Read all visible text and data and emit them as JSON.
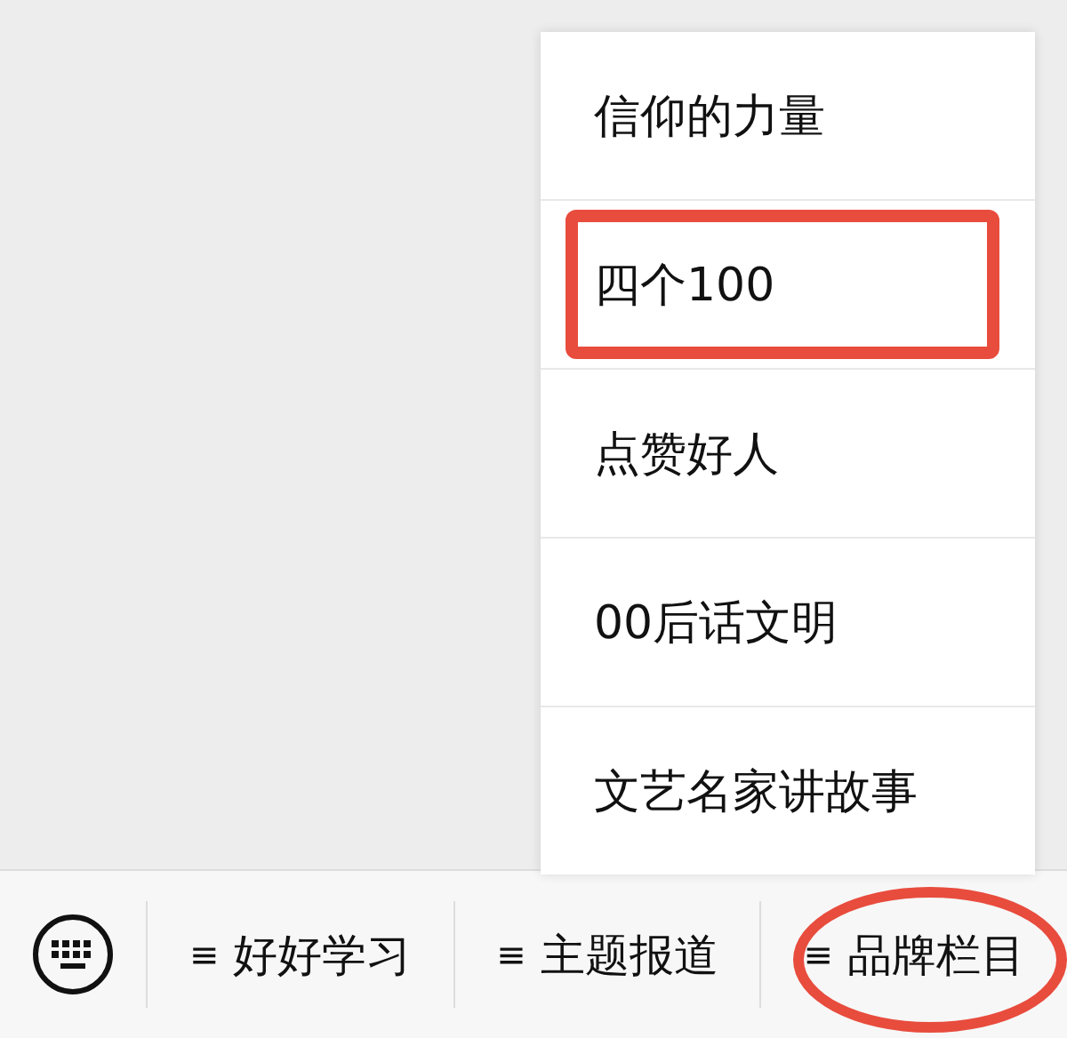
{
  "menu": {
    "items": [
      {
        "label": "信仰的力量",
        "highlighted": false
      },
      {
        "label": "四个100",
        "highlighted": true
      },
      {
        "label": "点赞好人",
        "highlighted": false
      },
      {
        "label": "00后话文明",
        "highlighted": false
      },
      {
        "label": "文艺名家讲故事",
        "highlighted": false
      }
    ]
  },
  "bottom_bar": {
    "tabs": [
      {
        "icon": "≡",
        "label": "好好学习",
        "circled": false
      },
      {
        "icon": "≡",
        "label": "主题报道",
        "circled": false
      },
      {
        "icon": "≡",
        "label": "品牌栏目",
        "circled": true
      }
    ]
  }
}
